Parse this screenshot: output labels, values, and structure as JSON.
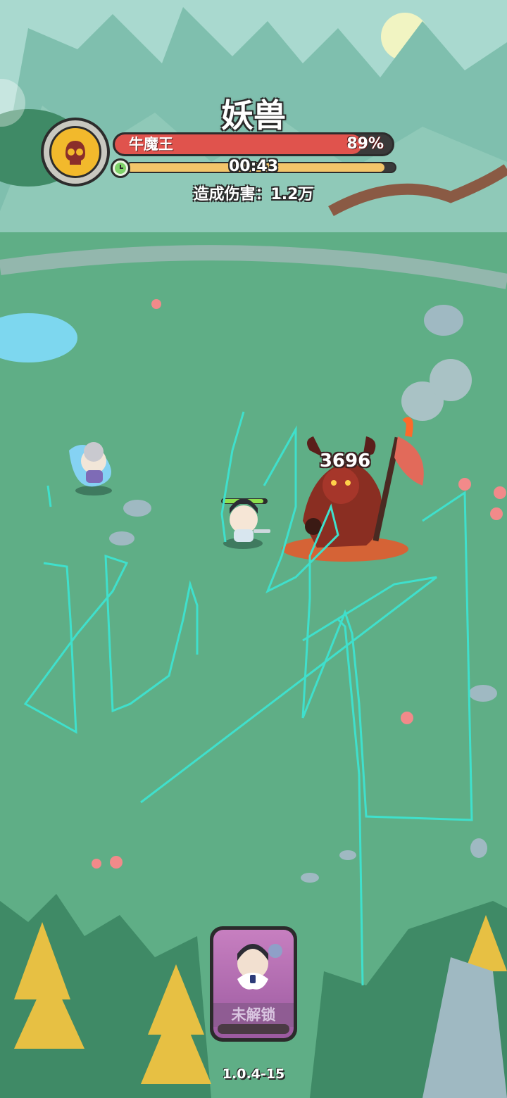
{
  "boss": {
    "title": "妖兽",
    "name": "牛魔王",
    "hp_percent_text": "89%",
    "hp_fraction": 0.89,
    "timer": "00:43",
    "timer_fraction": 0.96,
    "damage_text": "造成伤害：1.2万"
  },
  "battle": {
    "floating_damage": "3696"
  },
  "hero_card": {
    "label": "未解锁"
  },
  "version": "1.0.4-15",
  "colors": {
    "hp_fill": "#e0534d",
    "timer_fill": "#f3c56a",
    "grass": "#5fae86",
    "stroke": "#3fe0cc"
  }
}
